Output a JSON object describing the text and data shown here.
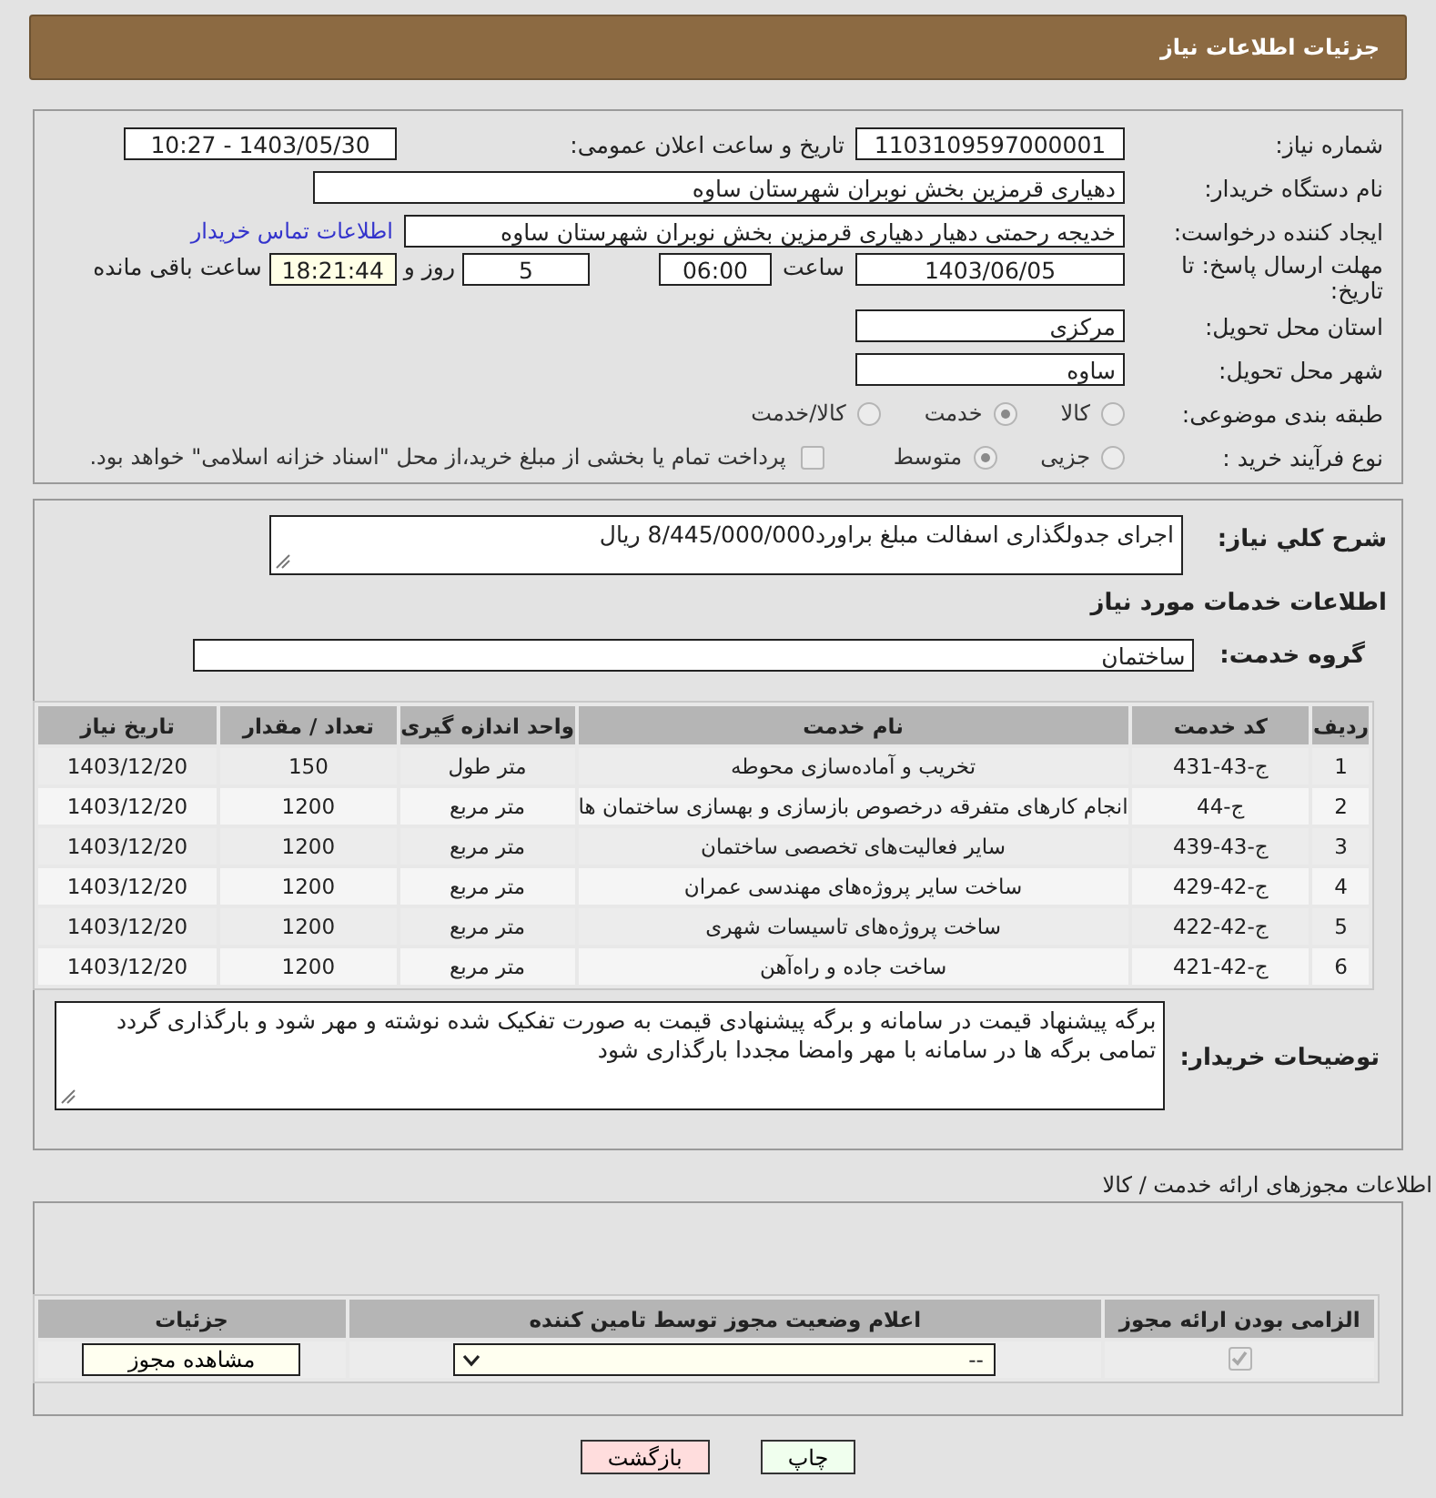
{
  "header": {
    "title": "جزئیات اطلاعات نیاز"
  },
  "details": {
    "need_number": {
      "label": "شماره نیاز:",
      "value": "1103109597000001"
    },
    "announce": {
      "label": "تاریخ و ساعت اعلان عمومی:",
      "value": "1403/05/30 - 10:27"
    },
    "buyer_org": {
      "label": "نام دستگاه خریدار:",
      "value": "دهیاری قرمزین بخش نوبران شهرستان ساوه"
    },
    "requester": {
      "label": "ایجاد کننده درخواست:",
      "value": "خدیجه رحمتی دهیار دهیاری قرمزین بخش نوبران شهرستان ساوه",
      "link": "اطلاعات تماس خریدار"
    },
    "deadline": {
      "label": "مهلت ارسال پاسخ: تا تاریخ:",
      "date": "1403/06/05",
      "time_label": "ساعت",
      "time": "06:00",
      "days": "5",
      "days_label": "روز و",
      "remaining": "18:21:44",
      "remaining_label": "ساعت باقی مانده"
    },
    "province": {
      "label": "استان محل تحویل:",
      "value": "مرکزی"
    },
    "city": {
      "label": "شهر محل تحویل:",
      "value": "ساوه"
    },
    "category": {
      "label": "طبقه بندی موضوعی:",
      "options": [
        {
          "label": "کالا",
          "selected": false
        },
        {
          "label": "خدمت",
          "selected": true
        },
        {
          "label": "کالا/خدمت",
          "selected": false
        }
      ]
    },
    "process": {
      "label": "نوع فرآیند خرید :",
      "options": [
        {
          "label": "جزیی",
          "selected": false
        },
        {
          "label": "متوسط",
          "selected": true
        }
      ],
      "treasury": {
        "label": "پرداخت تمام یا بخشی از مبلغ خرید،از محل \"اسناد خزانه اسلامی\" خواهد بود.",
        "checked": false
      }
    }
  },
  "summary": {
    "label": "شرح کلي نياز:",
    "value": "اجرای جدولگذاری اسفالت مبلغ براورد8/445/000/000 ریال"
  },
  "services_heading": "اطلاعات خدمات مورد نیاز",
  "service_group": {
    "label": "گروه خدمت:",
    "value": "ساختمان"
  },
  "table": {
    "columns": [
      "ردیف",
      "کد خدمت",
      "نام خدمت",
      "واحد اندازه گیری",
      "تعداد / مقدار",
      "تاریخ نیاز"
    ],
    "rows": [
      [
        "1",
        "ج-43-431",
        "تخریب و آماده‌سازی محوطه",
        "متر طول",
        "150",
        "1403/12/20"
      ],
      [
        "2",
        "ج-44",
        "انجام کارهای متفرقه درخصوص بازسازی و بهسازی ساختمان ها",
        "متر مربع",
        "1200",
        "1403/12/20"
      ],
      [
        "3",
        "ج-43-439",
        "سایر فعالیت‌های تخصصی ساختمان",
        "متر مربع",
        "1200",
        "1403/12/20"
      ],
      [
        "4",
        "ج-42-429",
        "ساخت سایر پروژه‌های مهندسی عمران",
        "متر مربع",
        "1200",
        "1403/12/20"
      ],
      [
        "5",
        "ج-42-422",
        "ساخت پروژه‌های تاسیسات شهری",
        "متر مربع",
        "1200",
        "1403/12/20"
      ],
      [
        "6",
        "ج-42-421",
        "ساخت جاده و راه‌آهن",
        "متر مربع",
        "1200",
        "1403/12/20"
      ]
    ]
  },
  "buyer_notes": {
    "label": "توضیحات خریدار:",
    "value": "برگه پیشنهاد قیمت در سامانه و برگه پیشنهادی قیمت به صورت تفکیک شده نوشته و مهر شود و بارگذاری گردد تمامی برگه ها در سامانه با مهر وامضا مجددا بارگذاری شود"
  },
  "permits": {
    "title": "اطلاعات مجوزهای ارائه خدمت / کالا",
    "columns": [
      "الزامی بودن ارائه مجوز",
      "اعلام وضعیت مجوز توسط تامین کننده",
      "جزئیات"
    ],
    "rows": [
      {
        "required": true,
        "status": "--",
        "action": "مشاهده مجوز"
      }
    ]
  },
  "buttons": [
    {
      "label": "چاپ",
      "kind": "print"
    },
    {
      "label": "بازگشت",
      "kind": "back"
    }
  ]
}
